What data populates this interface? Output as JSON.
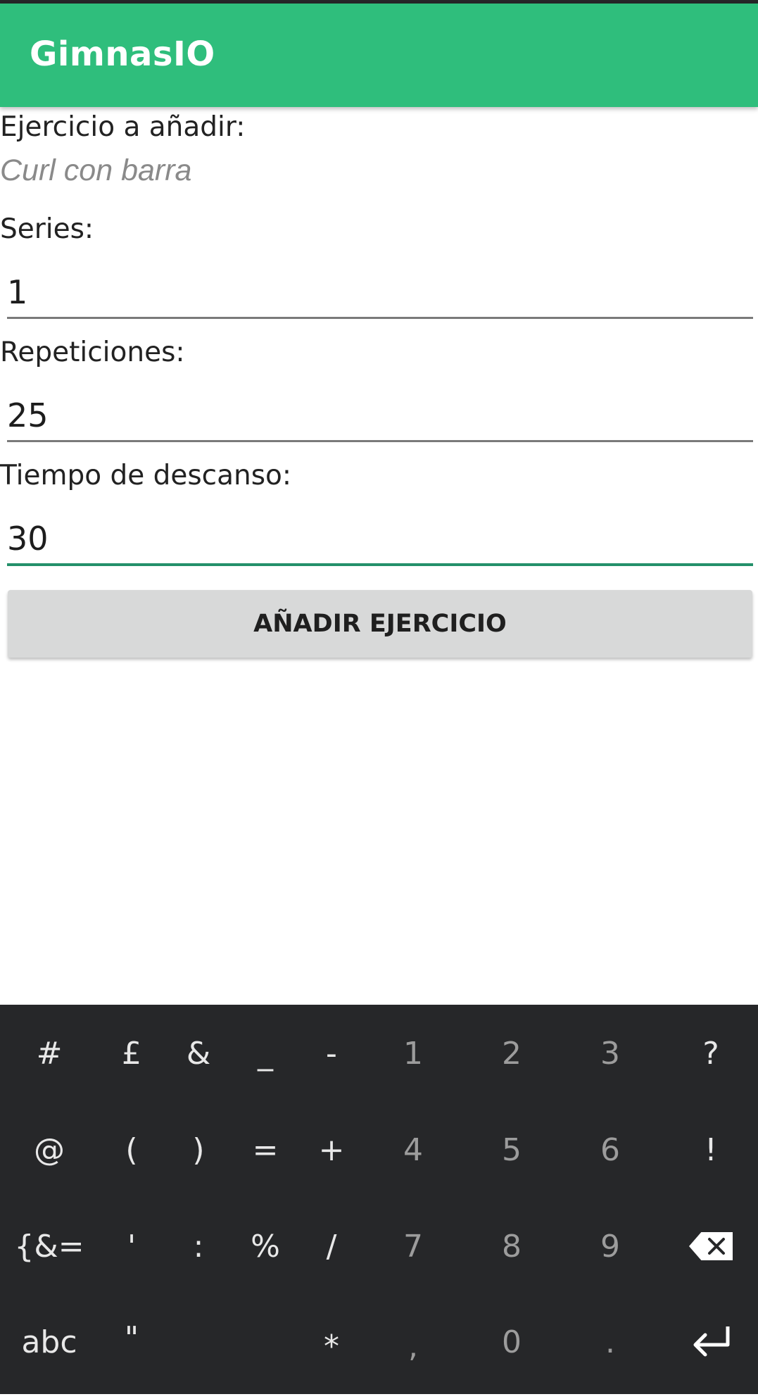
{
  "app": {
    "title": "GimnasIO",
    "accent_color": "#2fbe7c"
  },
  "form": {
    "exercise_label": "Ejercicio a añadir:",
    "exercise_name": "Curl con barra",
    "series_label": "Series:",
    "series_value": "1",
    "reps_label": "Repeticiones:",
    "reps_value": "25",
    "rest_label": "Tiempo de descanso:",
    "rest_value": "30",
    "submit_label": "AÑADIR EJERCICIO"
  },
  "keyboard": {
    "row1": [
      "#",
      "£",
      "&",
      "_",
      "-",
      "1",
      "2",
      "3",
      "?"
    ],
    "row2": [
      "@",
      "(",
      ")",
      "=",
      "+",
      "4",
      "5",
      "6",
      "!"
    ],
    "row3": [
      "{&=",
      "'",
      ":",
      "%",
      "/",
      "7",
      "8",
      "9"
    ],
    "row4": [
      "abc",
      "\"",
      "*",
      ",",
      "0",
      "."
    ],
    "icons": {
      "backspace": "backspace-icon",
      "enter": "enter-icon"
    }
  }
}
